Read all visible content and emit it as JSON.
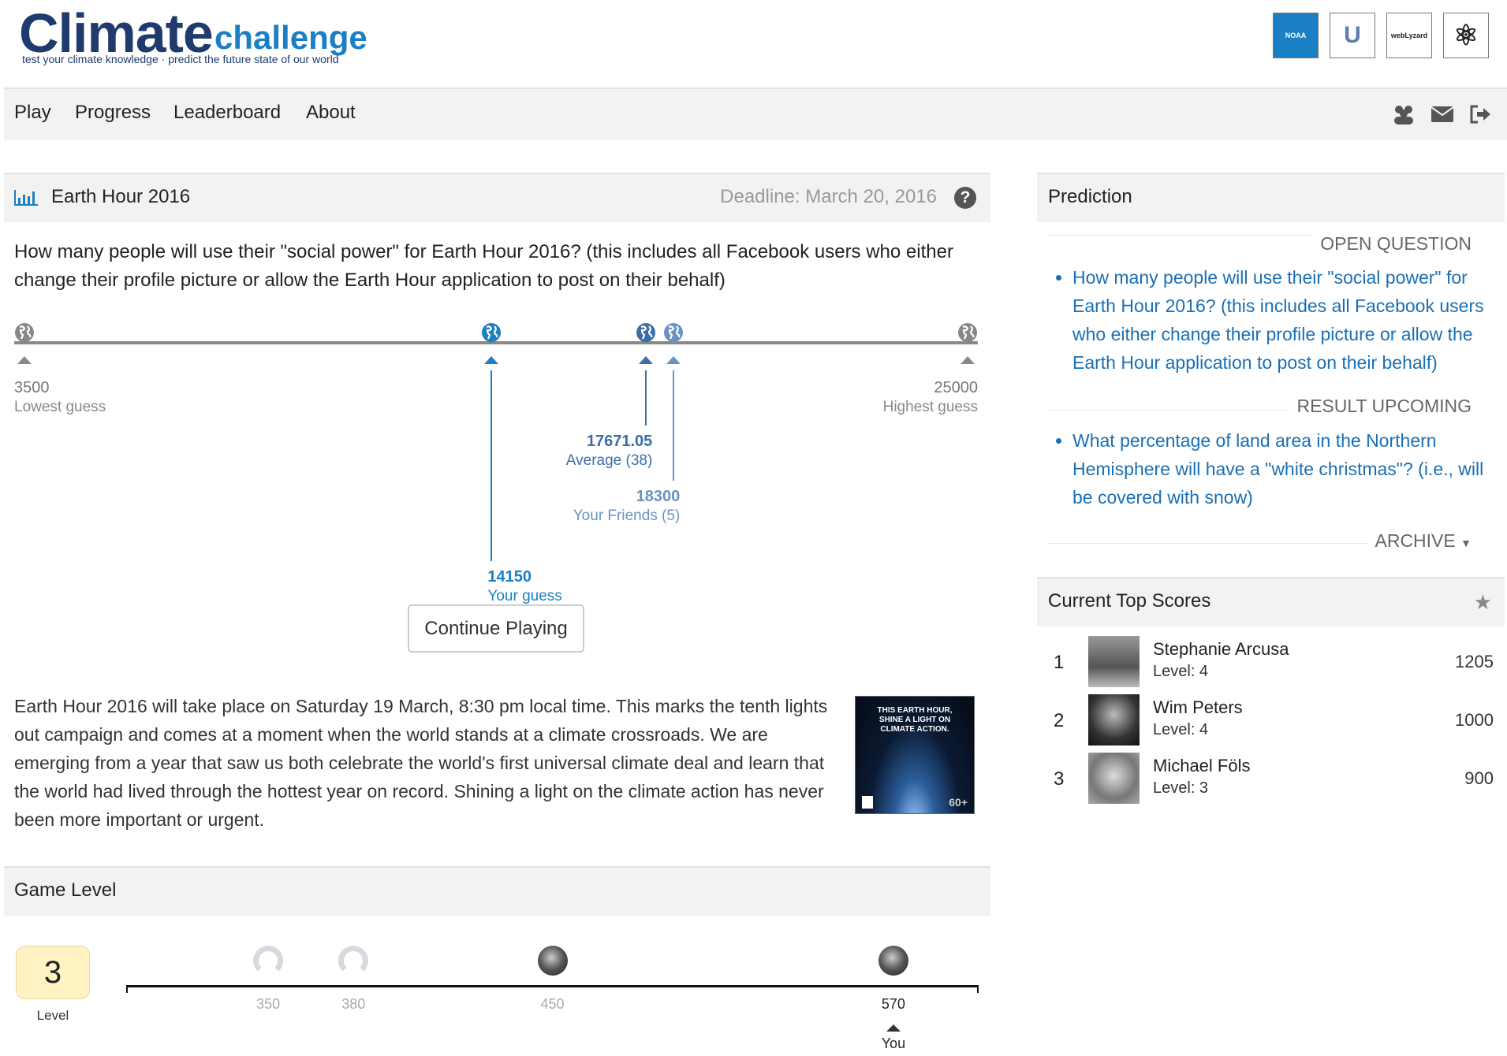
{
  "header": {
    "logo_main": "Climate",
    "logo_sub": "challenge",
    "tagline": "test your climate knowledge · predict the future state of our world",
    "partners": [
      {
        "name": "NOAA Climate",
        "label": "NOAA"
      },
      {
        "name": "University",
        "label": "U"
      },
      {
        "name": "webLyzard technology",
        "label": "webLyzard"
      },
      {
        "name": "network",
        "label": "⚛"
      }
    ]
  },
  "nav": {
    "items": [
      "Play",
      "Progress",
      "Leaderboard",
      "About"
    ],
    "icons": [
      "users-icon",
      "envelope-icon",
      "sign-out-icon"
    ]
  },
  "question_panel": {
    "title": "Earth Hour 2016",
    "deadline": "Deadline: March 20, 2016",
    "question": "How many people will use their \"social power\" for Earth Hour 2016? (this includes all Facebook users who either change their profile picture or allow the Earth Hour application to post on their behalf)",
    "guesses": {
      "min": 3500,
      "max": 25000,
      "lowest": {
        "value": "3500",
        "label": "Lowest guess"
      },
      "highest": {
        "value": "25000",
        "label": "Highest guess"
      },
      "yours": {
        "value": "14150",
        "label": "Your guess",
        "color": "#1a7fc4"
      },
      "average": {
        "value": "17671.05",
        "label": "Average (38)",
        "color": "#3b6ea5"
      },
      "friends": {
        "value": "18300",
        "label": "Your Friends (5)",
        "color": "#6a93c2"
      }
    },
    "continue_label": "Continue Playing",
    "description": "Earth Hour 2016 will take place on Saturday 19 March, 8:30 pm local time. This marks the tenth lights out campaign and comes at a moment when the world stands at a climate crossroads. We are emerging from a year that saw us both celebrate the world's first universal climate deal and learn that the world had lived through the hottest year on record. Shining a light on the climate action has never been more important or urgent.",
    "poster_text": "THIS EARTH HOUR, SHINE A LIGHT ON CLIMATE ACTION.",
    "poster_badge": "60+"
  },
  "game_level": {
    "title": "Game Level",
    "level": "3",
    "level_label": "Level",
    "range": [
      300,
      600
    ],
    "players": [
      {
        "score": 350,
        "label": "350",
        "avatar": "placeholder"
      },
      {
        "score": 380,
        "label": "380",
        "avatar": "placeholder"
      },
      {
        "score": 450,
        "label": "450",
        "avatar": "photo"
      },
      {
        "score": 570,
        "label": "570",
        "avatar": "photo",
        "you": true
      }
    ],
    "you_label": "You"
  },
  "prediction": {
    "title": "Prediction",
    "open_label": "OPEN QUESTION",
    "open_items": [
      "How many people will use their \"social power\" for Earth Hour 2016? (this includes all Facebook users who either change their profile picture or allow the Earth Hour application to post on their behalf)"
    ],
    "upcoming_label": "RESULT UPCOMING",
    "upcoming_items": [
      "What percentage of land area in the Northern Hemisphere will have a \"white christmas\"? (i.e., will be covered with snow)"
    ],
    "archive_label": "ARCHIVE"
  },
  "top_scores": {
    "title": "Current Top Scores",
    "rows": [
      {
        "rank": "1",
        "name": "Stephanie Arcusa",
        "level": "Level: 4",
        "score": "1205"
      },
      {
        "rank": "2",
        "name": "Wim Peters",
        "level": "Level: 4",
        "score": "1000"
      },
      {
        "rank": "3",
        "name": "Michael Föls",
        "level": "Level: 3",
        "score": "900"
      }
    ]
  }
}
